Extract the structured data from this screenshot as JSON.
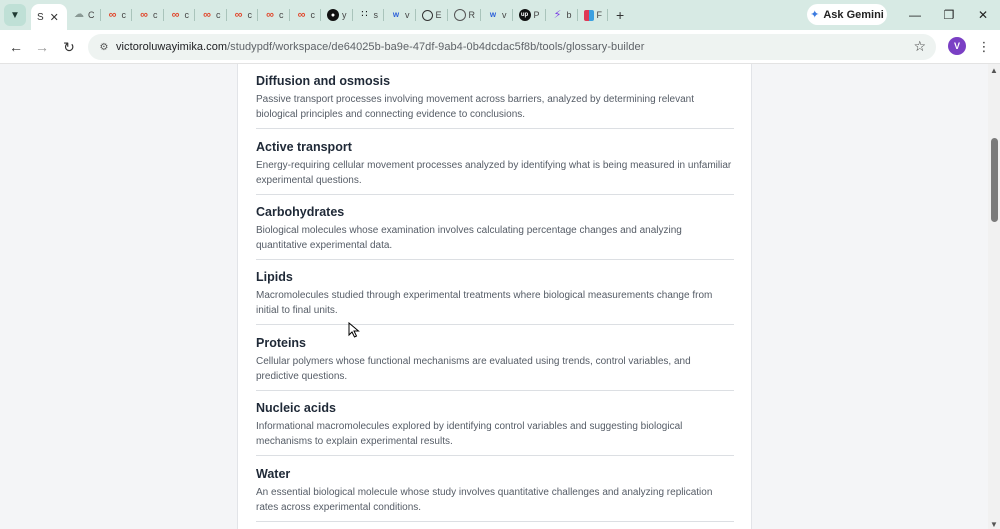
{
  "browser": {
    "tabs": [
      {
        "label": "S",
        "icon": "document-icon",
        "active": true
      },
      {
        "label": "C",
        "icon": "cloud-icon"
      },
      {
        "label": "c",
        "icon": "link-icon"
      },
      {
        "label": "c",
        "icon": "link-icon"
      },
      {
        "label": "c",
        "icon": "link-icon"
      },
      {
        "label": "c",
        "icon": "link-icon"
      },
      {
        "label": "c",
        "icon": "link-icon"
      },
      {
        "label": "c",
        "icon": "link-icon"
      },
      {
        "label": "c",
        "icon": "link-icon"
      },
      {
        "label": "y",
        "icon": "github-icon"
      },
      {
        "label": "s",
        "icon": "dots-icon"
      },
      {
        "label": "v",
        "icon": "wave-icon"
      },
      {
        "label": "E",
        "icon": "globe-icon"
      },
      {
        "label": "R",
        "icon": "ring-icon"
      },
      {
        "label": "v",
        "icon": "wave-icon"
      },
      {
        "label": "P",
        "icon": "upwork-icon"
      },
      {
        "label": "b",
        "icon": "bolt-icon"
      },
      {
        "label": "F",
        "icon": "figma-icon"
      }
    ],
    "ask_gemini_label": "Ask Gemini",
    "url_host": "victoroluwayimika.com",
    "url_path": "/studypdf/workspace/de64025b-ba9e-47df-9ab4-0b4dcdac5f8b/tools/glossary-builder",
    "avatar_letter": "V"
  },
  "glossary": {
    "entries": [
      {
        "term": "Diffusion and osmosis",
        "definition": "Passive transport processes involving movement across barriers, analyzed by determining relevant biological principles and connecting evidence to conclusions."
      },
      {
        "term": "Active transport",
        "definition": "Energy-requiring cellular movement processes analyzed by identifying what is being measured in unfamiliar experimental questions."
      },
      {
        "term": "Carbohydrates",
        "definition": "Biological molecules whose examination involves calculating percentage changes and analyzing quantitative experimental data."
      },
      {
        "term": "Lipids",
        "definition": "Macromolecules studied through experimental treatments where biological measurements change from initial to final units."
      },
      {
        "term": "Proteins",
        "definition": "Cellular polymers whose functional mechanisms are evaluated using trends, control variables, and predictive questions."
      },
      {
        "term": "Nucleic acids",
        "definition": "Informational macromolecules explored by identifying control variables and suggesting biological mechanisms to explain experimental results."
      },
      {
        "term": "Water",
        "definition": "An essential biological molecule whose study involves quantitative challenges and analyzing replication rates across experimental conditions."
      }
    ]
  }
}
